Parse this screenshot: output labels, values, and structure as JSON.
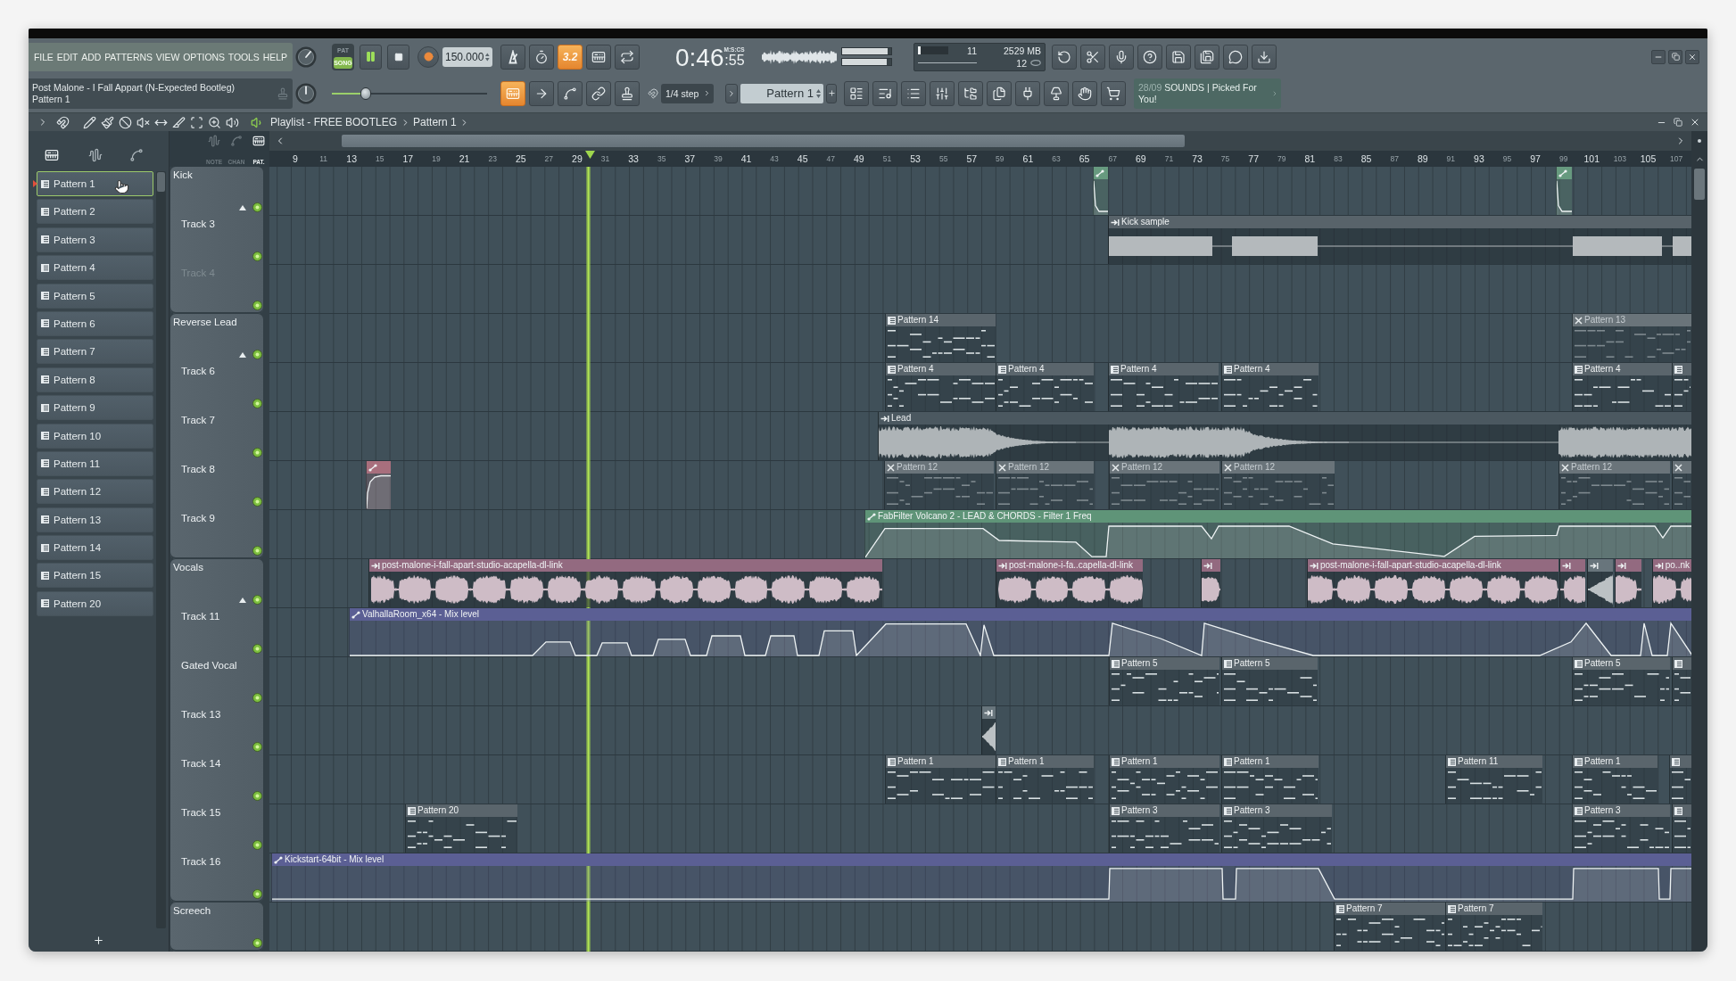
{
  "menu": [
    "FILE",
    "EDIT",
    "ADD",
    "PATTERNS",
    "VIEW",
    "OPTIONS",
    "TOOLS",
    "HELP"
  ],
  "song_info": {
    "title": "Post Malone - I Fall Appart (N-Expected Bootleg)",
    "pattern": "Pattern 1"
  },
  "transport": {
    "modes": [
      {
        "label": "PAT",
        "selected": false
      },
      {
        "label": "SONG",
        "selected": true
      }
    ],
    "playing": true,
    "tempo": "150.000"
  },
  "recording_toggles": [
    {
      "on": false
    },
    {
      "on": false
    },
    {
      "label": "3.2",
      "on": true
    },
    {
      "on": false
    },
    {
      "on": false
    }
  ],
  "time": {
    "value": "0:46",
    "fraction": ":55",
    "format": "M:S:CS"
  },
  "peak_meters": [
    {
      "level": 0.93
    },
    {
      "level": 0.9
    }
  ],
  "performance": {
    "cpu": "11",
    "cpu_meter": {
      "level": 0.08
    },
    "memory": "2529 MB",
    "polyphony": "12"
  },
  "pitch_slider": {
    "level": 0.22
  },
  "edit_toggles": [
    {
      "on": true
    },
    {
      "on": false
    },
    {
      "on": false
    },
    {
      "on": false
    },
    {
      "on": false
    }
  ],
  "snap": "1/4 step",
  "pattern_selector": {
    "value": "Pattern 1"
  },
  "hint_panel": {
    "date": "28/09",
    "text": "SOUNDS | Picked For You!"
  },
  "playlist": {
    "title": "Playlist - FREE BOOTLEG",
    "breadcrumb": "Pattern 1"
  },
  "view_modes": [
    {
      "label": "NOTE",
      "selected": false
    },
    {
      "label": "CHAN",
      "selected": false
    },
    {
      "label": "PAT.",
      "selected": true
    }
  ],
  "patterns": [
    {
      "name": "Pattern 1",
      "selected": true
    },
    {
      "name": "Pattern 2",
      "selected": false
    },
    {
      "name": "Pattern 3",
      "selected": false
    },
    {
      "name": "Pattern 4",
      "selected": false
    },
    {
      "name": "Pattern 5",
      "selected": false
    },
    {
      "name": "Pattern 6",
      "selected": false
    },
    {
      "name": "Pattern 7",
      "selected": false
    },
    {
      "name": "Pattern 8",
      "selected": false
    },
    {
      "name": "Pattern 9",
      "selected": false
    },
    {
      "name": "Pattern 10",
      "selected": false
    },
    {
      "name": "Pattern 11",
      "selected": false
    },
    {
      "name": "Pattern 12",
      "selected": false
    },
    {
      "name": "Pattern 13",
      "selected": false
    },
    {
      "name": "Pattern 14",
      "selected": false
    },
    {
      "name": "Pattern 15",
      "selected": false
    },
    {
      "name": "Pattern 20",
      "selected": false
    }
  ],
  "ruler": [
    "9",
    "11",
    "13",
    "15",
    "17",
    "19",
    "21",
    "23",
    "25",
    "27",
    "29",
    "31",
    "33",
    "35",
    "37",
    "39",
    "41",
    "43",
    "45",
    "47",
    "49",
    "51",
    "53",
    "55",
    "57",
    "59",
    "61",
    "63",
    "65",
    "67",
    "69",
    "71",
    "73",
    "75",
    "77",
    "79",
    "81",
    "83",
    "85",
    "87",
    "89",
    "91",
    "93",
    "95",
    "97",
    "99",
    "101",
    "103",
    "105",
    "107"
  ],
  "tracks": [
    {
      "name": "Kick",
      "active": true,
      "disabled": false,
      "clips": [
        {
          "kind": "automation",
          "color": "#679a7f",
          "muted": false
        },
        {
          "kind": "automation",
          "color": "#679a7f",
          "muted": false
        }
      ],
      "children": [
        {
          "name": "Track 3",
          "active": true,
          "disabled": false,
          "clips": [
            {
              "kind": "audio",
              "name": "Kick sample",
              "color": "#58636a",
              "muted": false
            }
          ]
        },
        {
          "name": "Track 4",
          "active": true,
          "disabled": true
        }
      ]
    },
    {
      "name": "Reverse Lead",
      "active": true,
      "disabled": false,
      "clips": [
        {
          "kind": "pattern",
          "name": "Pattern 14",
          "color": "#5a656c",
          "muted": false
        },
        {
          "kind": "pattern",
          "name": "Pattern 13",
          "color": "#6a747a",
          "muted": true
        }
      ],
      "children": [
        {
          "name": "Track 6",
          "active": true,
          "disabled": false,
          "clips": [
            {
              "kind": "pattern",
              "name": "Pattern 4",
              "color": "#5a656c",
              "muted": false
            },
            {
              "kind": "pattern",
              "name": "Pattern 4",
              "color": "#5a656c",
              "muted": false
            },
            {
              "kind": "pattern",
              "name": "Pattern 4",
              "color": "#5a656c",
              "muted": false
            },
            {
              "kind": "pattern",
              "name": "Pattern 4",
              "color": "#5a656c",
              "muted": false
            },
            {
              "kind": "pattern",
              "name": "Pattern 4",
              "color": "#5a656c",
              "muted": false
            },
            {
              "kind": "pattern",
              "color": "#5a656c",
              "muted": false
            }
          ]
        },
        {
          "name": "Track 7",
          "active": true,
          "disabled": false,
          "clips": [
            {
              "kind": "audio",
              "name": "Lead",
              "color": "#4b5860",
              "muted": false
            }
          ]
        },
        {
          "name": "Track 8",
          "active": true,
          "disabled": false,
          "clips": [
            {
              "kind": "automation",
              "color": "#a86f7d",
              "muted": false
            },
            {
              "kind": "pattern",
              "name": "Pattern 12",
              "color": "#6a747a",
              "muted": true
            },
            {
              "kind": "pattern",
              "name": "Pattern 12",
              "color": "#6a747a",
              "muted": true
            },
            {
              "kind": "pattern",
              "name": "Pattern 12",
              "color": "#6a747a",
              "muted": true
            },
            {
              "kind": "pattern",
              "name": "Pattern 12",
              "color": "#6a747a",
              "muted": true
            },
            {
              "kind": "pattern",
              "name": "Pattern 12",
              "color": "#6a747a",
              "muted": true
            },
            {
              "kind": "pattern",
              "color": "#6a747a",
              "muted": true
            }
          ]
        },
        {
          "name": "Track 9",
          "active": true,
          "disabled": false,
          "clips": [
            {
              "kind": "automation",
              "name": "FabFilter Volcano 2 - LEAD & CHORDS - Filter 1 Freq",
              "color": "#5f9478",
              "muted": false
            }
          ]
        }
      ]
    },
    {
      "name": "Vocals",
      "active": true,
      "disabled": false,
      "clips": [
        {
          "kind": "audio",
          "name": "post-malone-i-fall-apart-studio-acapella-dl-link",
          "color": "#936a80",
          "muted": false
        },
        {
          "kind": "audio",
          "name": "post-malone-i-fa..capella-dl-link",
          "color": "#936a80",
          "muted": false
        },
        {
          "kind": "audio",
          "color": "#936a80",
          "muted": false
        },
        {
          "kind": "audio",
          "name": "post-malone-i-fall-apart-studio-acapella-dl-link",
          "color": "#936a80",
          "muted": false
        },
        {
          "kind": "audio",
          "color": "#936a80",
          "muted": false
        },
        {
          "kind": "audio",
          "color": "#68757c",
          "muted": false
        },
        {
          "kind": "audio",
          "color": "#936a80",
          "muted": false
        },
        {
          "kind": "audio",
          "name": "po..nk",
          "color": "#936a80",
          "muted": false
        }
      ],
      "children": [
        {
          "name": "Track 11",
          "active": true,
          "disabled": false,
          "clips": [
            {
              "kind": "automation",
              "name": "ValhallaRoom_x64 - Mix level",
              "color": "#5b5f94",
              "muted": false
            }
          ]
        },
        {
          "name": "Gated Vocal",
          "active": true,
          "disabled": false,
          "clips": [
            {
              "kind": "pattern",
              "name": "Pattern 5",
              "color": "#5a656c",
              "muted": false
            },
            {
              "kind": "pattern",
              "name": "Pattern 5",
              "color": "#5a656c",
              "muted": false
            },
            {
              "kind": "pattern",
              "name": "Pattern 5",
              "color": "#5a656c",
              "muted": false
            },
            {
              "kind": "pattern",
              "color": "#5a656c",
              "muted": false
            }
          ]
        },
        {
          "name": "Track 13",
          "active": true,
          "disabled": false,
          "clips": [
            {
              "kind": "audio",
              "color": "#68757c",
              "muted": false
            }
          ]
        },
        {
          "name": "Track 14",
          "active": true,
          "disabled": false,
          "clips": [
            {
              "kind": "pattern",
              "name": "Pattern 1",
              "color": "#5a656c",
              "muted": false
            },
            {
              "kind": "pattern",
              "name": "Pattern 1",
              "color": "#5a656c",
              "muted": false
            },
            {
              "kind": "pattern",
              "name": "Pattern 1",
              "color": "#5a656c",
              "muted": false
            },
            {
              "kind": "pattern",
              "name": "Pattern 1",
              "color": "#5a656c",
              "muted": false
            },
            {
              "kind": "pattern",
              "name": "Pattern 11",
              "color": "#5a656c",
              "muted": false
            },
            {
              "kind": "pattern",
              "name": "Pattern 1",
              "color": "#5a656c",
              "muted": false
            },
            {
              "kind": "pattern",
              "color": "#5a656c",
              "muted": false
            }
          ]
        },
        {
          "name": "Track 15",
          "active": true,
          "disabled": false,
          "clips": [
            {
              "kind": "pattern",
              "name": "Pattern 20",
              "color": "#5a656c",
              "muted": false
            },
            {
              "kind": "pattern",
              "name": "Pattern 3",
              "color": "#5a656c",
              "muted": false
            },
            {
              "kind": "pattern",
              "name": "Pattern 3",
              "color": "#5a656c",
              "muted": false
            },
            {
              "kind": "pattern",
              "name": "Pattern 3",
              "color": "#5a656c",
              "muted": false
            },
            {
              "kind": "pattern",
              "color": "#5a656c",
              "muted": false
            }
          ]
        },
        {
          "name": "Track 16",
          "active": true,
          "disabled": false,
          "clips": [
            {
              "kind": "automation",
              "name": "Kickstart-64bit - Mix level",
              "color": "#5b5f94",
              "muted": false
            }
          ]
        }
      ]
    },
    {
      "name": "Screech",
      "active": true,
      "disabled": false,
      "clips": [
        {
          "kind": "pattern",
          "name": "Pattern 7",
          "color": "#5a656c",
          "muted": false
        },
        {
          "kind": "pattern",
          "name": "Pattern 7",
          "color": "#5a656c",
          "muted": false
        }
      ]
    }
  ]
}
